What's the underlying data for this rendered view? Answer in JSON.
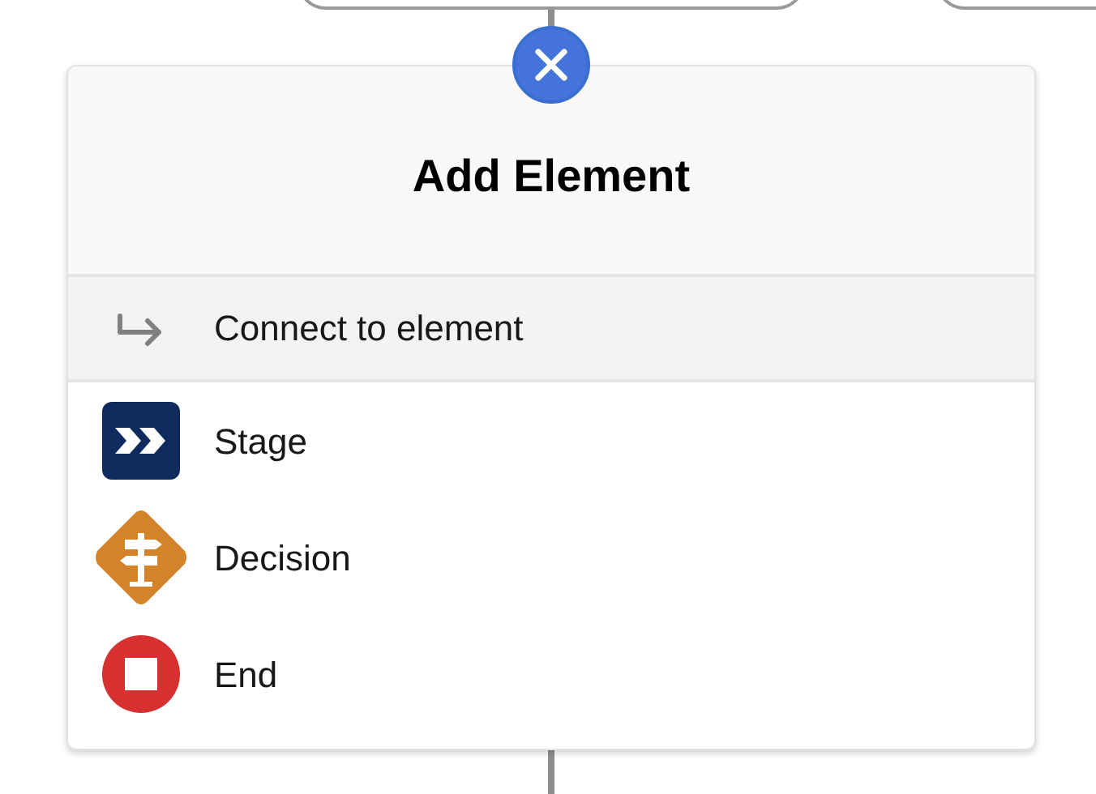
{
  "panel": {
    "title": "Add Element"
  },
  "options": [
    {
      "kind": "connect",
      "label": "Connect to element",
      "selected": true
    },
    {
      "kind": "stage",
      "label": "Stage",
      "selected": false
    },
    {
      "kind": "decision",
      "label": "Decision",
      "selected": false
    },
    {
      "kind": "end",
      "label": "End",
      "selected": false
    }
  ]
}
